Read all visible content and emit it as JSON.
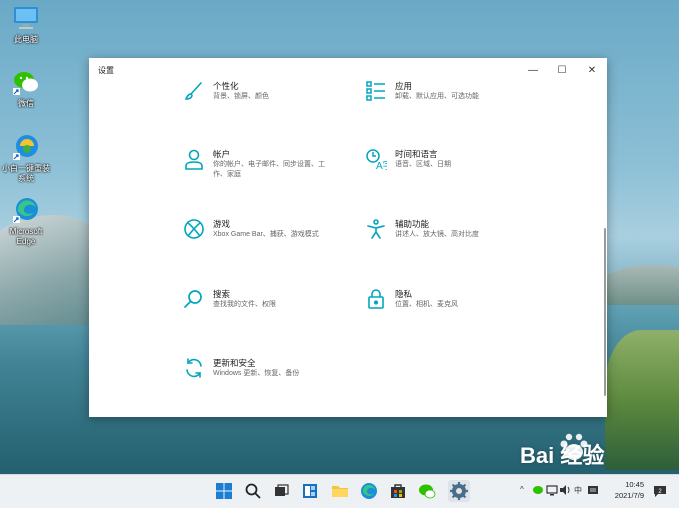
{
  "desktop": {
    "icons": [
      {
        "label": "此电脑"
      },
      {
        "label": "微信"
      },
      {
        "label": "小白一键重装系统"
      },
      {
        "label": "Microsoft Edge"
      }
    ]
  },
  "window": {
    "title": "设置",
    "controls": {
      "minimize": "—",
      "maximize": "☐",
      "close": "✕"
    },
    "tiles": [
      {
        "title": "个性化",
        "desc": "背景、锁屏、颜色"
      },
      {
        "title": "应用",
        "desc": "卸载、默认应用、可选功能"
      },
      {
        "title": "帐户",
        "desc": "你的帐户、电子邮件、同步设置、工作、家庭"
      },
      {
        "title": "时间和语言",
        "desc": "语音、区域、日期"
      },
      {
        "title": "游戏",
        "desc": "Xbox Game Bar、捕获、游戏模式"
      },
      {
        "title": "辅助功能",
        "desc": "讲述人、放大镜、高对比度"
      },
      {
        "title": "搜索",
        "desc": "查找我的文件、权限"
      },
      {
        "title": "隐私",
        "desc": "位置、相机、麦克风"
      },
      {
        "title": "更新和安全",
        "desc": "Windows 更新、恢复、备份"
      }
    ]
  },
  "taskbar": {
    "tray_chevron": "^",
    "ime": "中",
    "time": "10:45",
    "date": "2021/7/9"
  },
  "watermark": {
    "text": "Bai 经验"
  },
  "colors": {
    "accent": "#00a6bd"
  }
}
